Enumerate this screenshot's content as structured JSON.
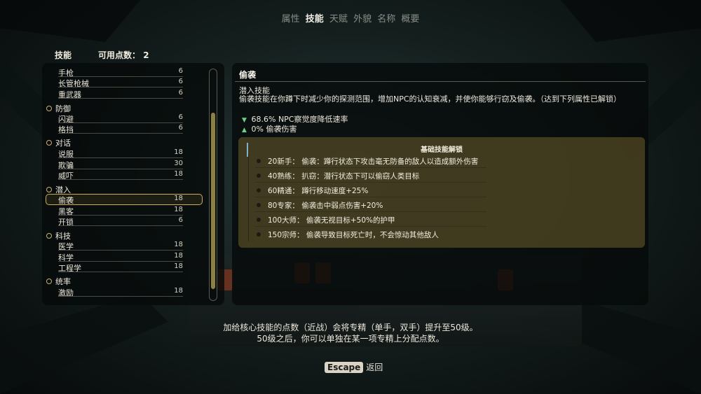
{
  "tabs": [
    {
      "label": "属性",
      "active": false
    },
    {
      "label": "技能",
      "active": true
    },
    {
      "label": "天赋",
      "active": false
    },
    {
      "label": "外貌",
      "active": false
    },
    {
      "label": "名称",
      "active": false
    },
    {
      "label": "概要",
      "active": false
    }
  ],
  "left_header": {
    "title": "技能",
    "points_label": "可用点数：",
    "points_value": "2"
  },
  "skills": {
    "r0": {
      "name": "手枪",
      "value": "6"
    },
    "r1": {
      "name": "长管枪械",
      "value": "6"
    },
    "r2": {
      "name": "重武器",
      "value": "6"
    },
    "c0": {
      "name": "防御"
    },
    "r3": {
      "name": "闪避",
      "value": "6"
    },
    "r4": {
      "name": "格挡",
      "value": "6"
    },
    "c1": {
      "name": "对话"
    },
    "r5": {
      "name": "说服",
      "value": "18"
    },
    "r6": {
      "name": "欺骗",
      "value": "30"
    },
    "r7": {
      "name": "威吓",
      "value": "18"
    },
    "c2": {
      "name": "潜入"
    },
    "r8": {
      "name": "偷袭",
      "value": "18"
    },
    "r9": {
      "name": "黑客",
      "value": "18"
    },
    "r10": {
      "name": "开锁",
      "value": "6"
    },
    "c3": {
      "name": "科技"
    },
    "r11": {
      "name": "医学",
      "value": "18"
    },
    "r12": {
      "name": "科学",
      "value": "18"
    },
    "r13": {
      "name": "工程学",
      "value": "18"
    },
    "c4": {
      "name": "统率"
    },
    "r14": {
      "name": "激励",
      "value": "18"
    }
  },
  "detail": {
    "title": "偷袭",
    "subtitle": "潜入技能",
    "description": "偷袭技能在你蹲下时减少你的探测范围，增加NPC的认知衰减，并使你能够行窃及偷袭。（达到下列属性已解锁）",
    "effects": [
      {
        "icon": "arrow-down-icon",
        "glyph": "▼",
        "text": "68.6% NPC察觉度降低速率"
      },
      {
        "icon": "arrow-up-icon",
        "glyph": "▲",
        "text": "0% 偷袭伤害"
      }
    ],
    "unlocks_title": "基础技能解锁",
    "unlocks": [
      "20新手： 偷袭：蹲行状态下攻击毫无防备的敌人以造成额外伤害",
      "40熟练： 扒窃：潜行状态下可以偷窃人类目标",
      "60精通： 蹲行移动速度+25%",
      "80专家： 偷袭击中弱点伤害+20%",
      "100大师： 偷袭无视目标+50%的护甲",
      "150宗师： 偷袭导致目标死亡时，不会惊动其他敌人"
    ]
  },
  "hint": {
    "line1": "加给核心技能的点数（近战）会将专精（单手，双手）提升至50级。",
    "line2": "50级之后，你可以单独在某一项专精上分配点数。"
  },
  "footer": {
    "key": "Escape",
    "label": "返回"
  },
  "colors": {
    "accent": "#c9ad5a",
    "unlock_bg": "#6e5f2d",
    "effect_icon": "#6fd08a"
  }
}
